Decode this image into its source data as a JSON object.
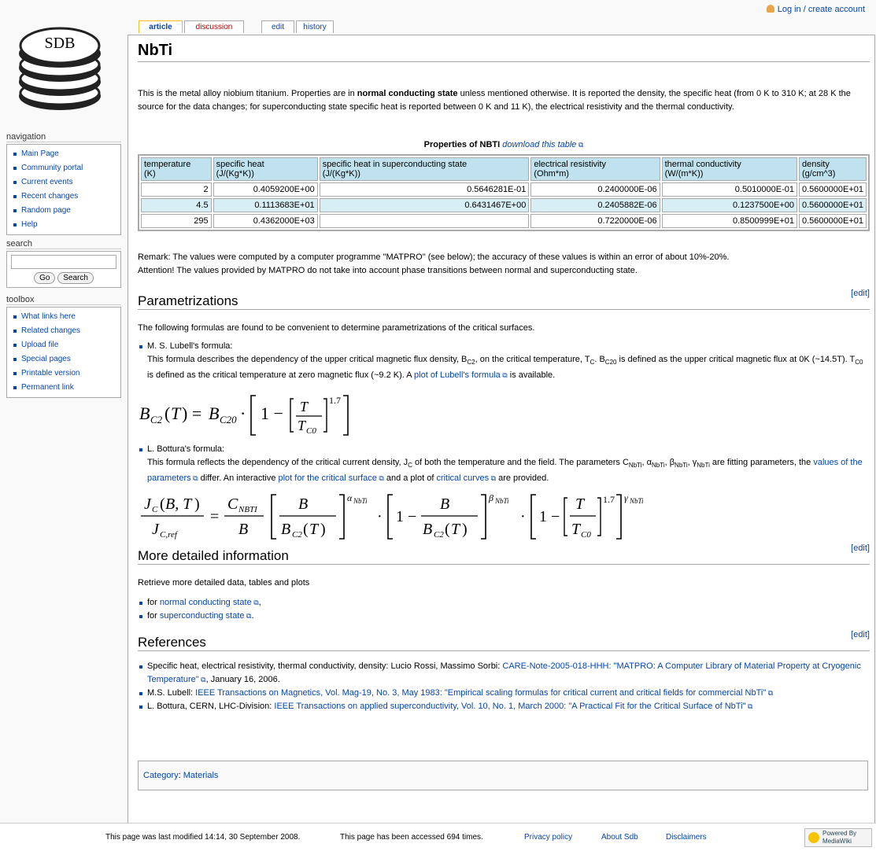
{
  "personal": {
    "login_label": "Log in / create account"
  },
  "logo": {
    "text": "SDB"
  },
  "tabs": [
    {
      "label": "article"
    },
    {
      "label": "discussion"
    },
    {
      "label": "edit"
    },
    {
      "label": "history"
    }
  ],
  "navigation": {
    "heading": "navigation",
    "items": [
      "Main Page",
      "Community portal",
      "Current events",
      "Recent changes",
      "Random page",
      "Help"
    ]
  },
  "search": {
    "heading": "search",
    "go_label": "Go",
    "search_label": "Search",
    "value": ""
  },
  "toolbox": {
    "heading": "toolbox",
    "items": [
      "What links here",
      "Related changes",
      "Upload file",
      "Special pages",
      "Printable version",
      "Permanent link"
    ]
  },
  "page": {
    "title": "NbTi",
    "intro_1": "This is the metal alloy niobium titanium. Properties are in ",
    "intro_bold": "normal conducting state",
    "intro_2": " unless mentioned otherwise. It is reported the density, the specific heat (from 0 K to 310 K; at 28 K the source for the data changes; for superconducting state specific heat is reported between 0 K and 11 K), the electrical resistivity and the thermal conductivity.",
    "table_caption": "Properties of NBTI",
    "table_download": "download this table",
    "table_headers": [
      [
        "temperature",
        "(K)"
      ],
      [
        "specific heat",
        "(J/(Kg*K))"
      ],
      [
        "specific heat in superconducting state",
        "(J/(Kg*K))"
      ],
      [
        "electrical resistivity",
        "(Ohm*m)"
      ],
      [
        "thermal conductivity",
        "(W/(m*K))"
      ],
      [
        "density",
        "(g/cm^3)"
      ]
    ],
    "table_rows": [
      [
        "2",
        "0.4059200E+00",
        "0.5646281E-01",
        "0.2400000E-06",
        "0.5010000E-01",
        "0.5600000E+01"
      ],
      [
        "4.5",
        "0.1113683E+01",
        "0.6431467E+00",
        "0.2405882E-06",
        "0.1237500E+00",
        "0.5600000E+01"
      ],
      [
        "295",
        "0.4362000E+03",
        "",
        "0.7220000E-06",
        "0.8500999E+01",
        "0.5600000E+01"
      ]
    ],
    "remark_1": "Remark: The values were computed by a computer programme \"MATPRO\" (see below); the accuracy of these values is within an error of about 10%-20%.",
    "remark_2": "Attention! The values provided by MATPRO do not take into account phase transitions between normal and superconducting state.",
    "edit_label": "[edit]",
    "param_heading": "Parametrizations",
    "param_intro": "The following formulas are found to be convenient to determine parametrizations of the critical surfaces.",
    "lubell_title": "M. S. Lubell's formula:",
    "lubell_desc_1": "This formula describes the dependency of the upper critical magnetic flux density, B",
    "lubell_desc_2": ", on the critical temperature, T",
    "lubell_desc_3": " is defined as the upper critical magnetic flux at 0K (~14.5T). T",
    "lubell_desc_4": " is defined as the critical temperature at zero magnetic flux (~9.2 K). A ",
    "lubell_link": "plot of Lubell's formula",
    "lubell_desc_5": " is available.",
    "bottura_title": "L. Bottura's formula:",
    "bottura_desc_1": "This formula reflects the dependency of the critical current density, J",
    "bottura_desc_2": " of both the temperature and the field. The parameters C",
    "bottura_desc_3": " fitting parameters, the ",
    "bottura_link_1": "values of the parameters",
    "bottura_desc_4": " differ. An interactive ",
    "bottura_link_2": "plot for the critical surface",
    "bottura_desc_5": " and a plot of ",
    "bottura_link_3": "critical curves",
    "bottura_desc_6": " are provided.",
    "more_heading": "More detailed information",
    "more_intro": "Retrieve more detailed data, tables and plots",
    "more_items": [
      {
        "pre": "for ",
        "link": "normal conducting state",
        "post": ","
      },
      {
        "pre": "for ",
        "link": "superconducting state",
        "post": "."
      }
    ],
    "ref_heading": "References",
    "references": [
      {
        "pre": "Specific heat, electrical resistivity, thermal conductivity, density: Lucio Rossi, Massimo Sorbi: ",
        "link": "CARE-Note-2005-018-HHH: \"MATPRO: A Computer Library of Material Property at Cryogenic Temperature\"",
        "post": ", January 16, 2006."
      },
      {
        "pre": "M.S. Lubell: ",
        "link": "IEEE Transactions on Magnetics, Vol. Mag-19, No. 3, May 1983: \"Empirical scaling formulas for critical current and critical fields for commercial NbTi\"",
        "post": ""
      },
      {
        "pre": "L. Bottura, CERN, LHC-Division: ",
        "link": "IEEE Transactions on applied superconductivity, Vol. 10, No. 1, March 2000: \"A Practical Fit for the Critical Surface of NbTi\"",
        "post": ""
      }
    ],
    "category_label": "Category",
    "category_value": "Materials"
  },
  "footer": {
    "modified": "This page was last modified 14:14, 30 September 2008.",
    "accessed": "This page has been accessed 694 times.",
    "privacy": "Privacy policy",
    "about": "About Sdb",
    "disclaimers": "Disclaimers",
    "badge": "Powered By MediaWiki"
  },
  "colors": {
    "link": "#0645ad",
    "new_link": "#ba0000",
    "table_header": "#bfe2ee",
    "table_alt_row": "#d8eef5",
    "tab_selected": "#fabd23"
  }
}
